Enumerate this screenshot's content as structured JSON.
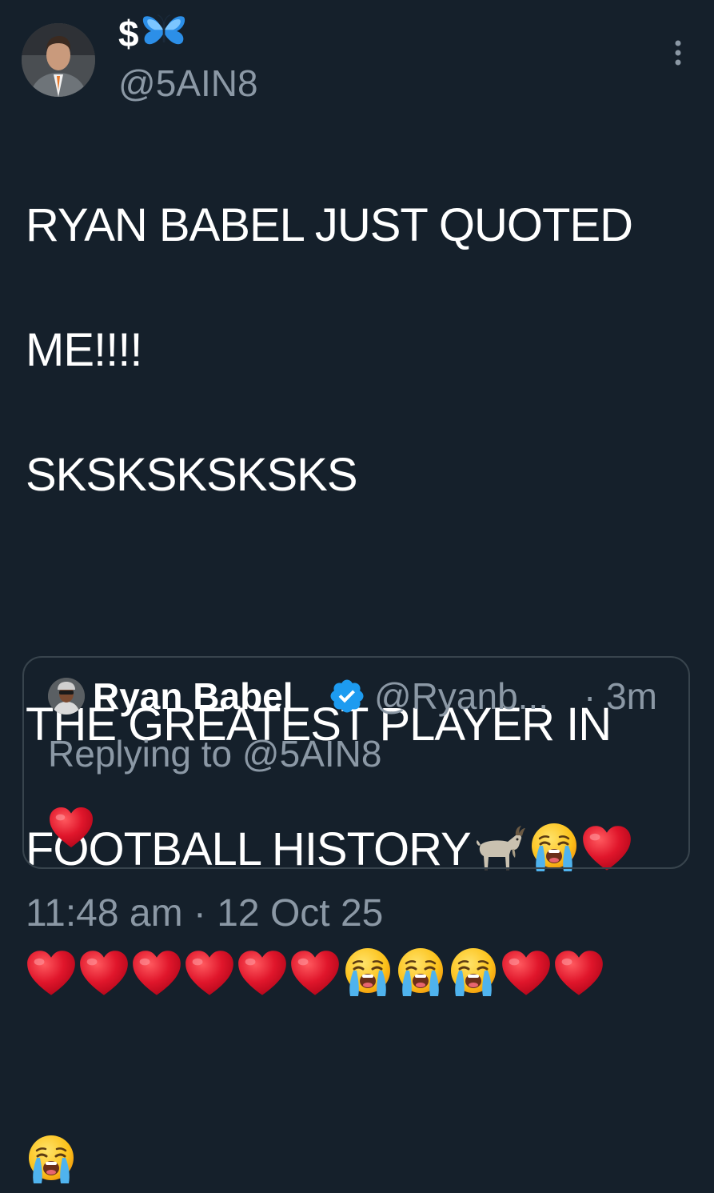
{
  "author": {
    "display_name": "$",
    "display_name_emoji": "butterfly-icon",
    "handle": "@5AIN8"
  },
  "tweet": {
    "line1": "RYAN BABEL JUST QUOTED",
    "line2": "ME!!!!",
    "line3": "SKSKSKSKSKS",
    "line4": "THE GREATEST PLAYER IN",
    "line5": "FOOTBALL HISTORY",
    "line5_emojis": [
      "goat-icon",
      "loudly-crying-face-icon",
      "red-heart-icon"
    ],
    "line6_emojis": [
      "red-heart-icon",
      "red-heart-icon",
      "red-heart-icon",
      "red-heart-icon",
      "red-heart-icon",
      "red-heart-icon",
      "loudly-crying-face-icon",
      "loudly-crying-face-icon",
      "loudly-crying-face-icon",
      "red-heart-icon",
      "red-heart-icon"
    ],
    "line7_emojis": [
      "loudly-crying-face-icon"
    ]
  },
  "quoted_tweet": {
    "name": "Ryan Babel",
    "verified_icon": "verified-badge-icon",
    "handle": "@Ryanb...",
    "time": "· 3m",
    "replying_to": "Replying to @5AIN8",
    "body_emoji": "red-heart-icon"
  },
  "timestamp": "11:48 am · 12 Oct 25",
  "colors": {
    "background": "#15202b",
    "primary_text": "#ffffff",
    "secondary_text": "#8b98a5",
    "border": "#38444d",
    "verified_blue": "#1d9bf0",
    "heart_red": "#e0162b",
    "emoji_yellow": "#fcc21b",
    "tear_blue": "#4fb3ee"
  }
}
